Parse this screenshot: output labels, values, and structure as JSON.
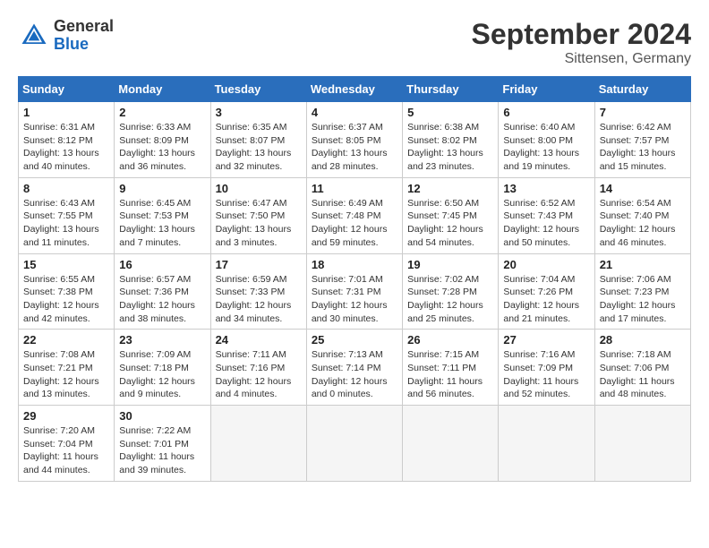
{
  "header": {
    "logo": {
      "line1": "General",
      "line2": "Blue"
    },
    "title": "September 2024",
    "location": "Sittensen, Germany"
  },
  "days_of_week": [
    "Sunday",
    "Monday",
    "Tuesday",
    "Wednesday",
    "Thursday",
    "Friday",
    "Saturday"
  ],
  "weeks": [
    [
      {
        "day": 1,
        "sunrise": "6:31 AM",
        "sunset": "8:12 PM",
        "daylight": "13 hours and 40 minutes."
      },
      {
        "day": 2,
        "sunrise": "6:33 AM",
        "sunset": "8:09 PM",
        "daylight": "13 hours and 36 minutes."
      },
      {
        "day": 3,
        "sunrise": "6:35 AM",
        "sunset": "8:07 PM",
        "daylight": "13 hours and 32 minutes."
      },
      {
        "day": 4,
        "sunrise": "6:37 AM",
        "sunset": "8:05 PM",
        "daylight": "13 hours and 28 minutes."
      },
      {
        "day": 5,
        "sunrise": "6:38 AM",
        "sunset": "8:02 PM",
        "daylight": "13 hours and 23 minutes."
      },
      {
        "day": 6,
        "sunrise": "6:40 AM",
        "sunset": "8:00 PM",
        "daylight": "13 hours and 19 minutes."
      },
      {
        "day": 7,
        "sunrise": "6:42 AM",
        "sunset": "7:57 PM",
        "daylight": "13 hours and 15 minutes."
      }
    ],
    [
      {
        "day": 8,
        "sunrise": "6:43 AM",
        "sunset": "7:55 PM",
        "daylight": "13 hours and 11 minutes."
      },
      {
        "day": 9,
        "sunrise": "6:45 AM",
        "sunset": "7:53 PM",
        "daylight": "13 hours and 7 minutes."
      },
      {
        "day": 10,
        "sunrise": "6:47 AM",
        "sunset": "7:50 PM",
        "daylight": "13 hours and 3 minutes."
      },
      {
        "day": 11,
        "sunrise": "6:49 AM",
        "sunset": "7:48 PM",
        "daylight": "12 hours and 59 minutes."
      },
      {
        "day": 12,
        "sunrise": "6:50 AM",
        "sunset": "7:45 PM",
        "daylight": "12 hours and 54 minutes."
      },
      {
        "day": 13,
        "sunrise": "6:52 AM",
        "sunset": "7:43 PM",
        "daylight": "12 hours and 50 minutes."
      },
      {
        "day": 14,
        "sunrise": "6:54 AM",
        "sunset": "7:40 PM",
        "daylight": "12 hours and 46 minutes."
      }
    ],
    [
      {
        "day": 15,
        "sunrise": "6:55 AM",
        "sunset": "7:38 PM",
        "daylight": "12 hours and 42 minutes."
      },
      {
        "day": 16,
        "sunrise": "6:57 AM",
        "sunset": "7:36 PM",
        "daylight": "12 hours and 38 minutes."
      },
      {
        "day": 17,
        "sunrise": "6:59 AM",
        "sunset": "7:33 PM",
        "daylight": "12 hours and 34 minutes."
      },
      {
        "day": 18,
        "sunrise": "7:01 AM",
        "sunset": "7:31 PM",
        "daylight": "12 hours and 30 minutes."
      },
      {
        "day": 19,
        "sunrise": "7:02 AM",
        "sunset": "7:28 PM",
        "daylight": "12 hours and 25 minutes."
      },
      {
        "day": 20,
        "sunrise": "7:04 AM",
        "sunset": "7:26 PM",
        "daylight": "12 hours and 21 minutes."
      },
      {
        "day": 21,
        "sunrise": "7:06 AM",
        "sunset": "7:23 PM",
        "daylight": "12 hours and 17 minutes."
      }
    ],
    [
      {
        "day": 22,
        "sunrise": "7:08 AM",
        "sunset": "7:21 PM",
        "daylight": "12 hours and 13 minutes."
      },
      {
        "day": 23,
        "sunrise": "7:09 AM",
        "sunset": "7:18 PM",
        "daylight": "12 hours and 9 minutes."
      },
      {
        "day": 24,
        "sunrise": "7:11 AM",
        "sunset": "7:16 PM",
        "daylight": "12 hours and 4 minutes."
      },
      {
        "day": 25,
        "sunrise": "7:13 AM",
        "sunset": "7:14 PM",
        "daylight": "12 hours and 0 minutes."
      },
      {
        "day": 26,
        "sunrise": "7:15 AM",
        "sunset": "7:11 PM",
        "daylight": "11 hours and 56 minutes."
      },
      {
        "day": 27,
        "sunrise": "7:16 AM",
        "sunset": "7:09 PM",
        "daylight": "11 hours and 52 minutes."
      },
      {
        "day": 28,
        "sunrise": "7:18 AM",
        "sunset": "7:06 PM",
        "daylight": "11 hours and 48 minutes."
      }
    ],
    [
      {
        "day": 29,
        "sunrise": "7:20 AM",
        "sunset": "7:04 PM",
        "daylight": "11 hours and 44 minutes."
      },
      {
        "day": 30,
        "sunrise": "7:22 AM",
        "sunset": "7:01 PM",
        "daylight": "11 hours and 39 minutes."
      },
      null,
      null,
      null,
      null,
      null
    ]
  ]
}
